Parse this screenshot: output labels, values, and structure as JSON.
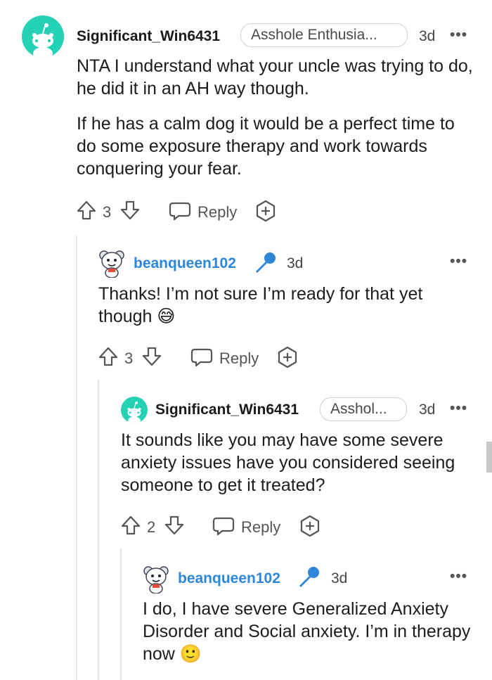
{
  "comments": [
    {
      "username": "Significant_Win6431",
      "flair": "Asshole Enthusia...",
      "age": "3d",
      "more": "•••",
      "paragraphs": [
        "NTA I understand what your uncle was trying to do, he did it in an AH way though.",
        "If he has a calm dog it would be a perfect time to do some exposure therapy and work towards conquering your fear."
      ],
      "votes": "3",
      "reply_label": "Reply"
    },
    {
      "username": "beanqueen102",
      "age": "3d",
      "more": "•••",
      "paragraphs": [
        "Thanks! I’m not sure I’m ready for that yet though 😅"
      ],
      "votes": "3",
      "reply_label": "Reply"
    },
    {
      "username": "Significant_Win6431",
      "flair": "Asshol...",
      "age": "3d",
      "more": "•••",
      "paragraphs": [
        "It sounds like you may have some severe anxiety issues have you considered seeing someone to get it treated?"
      ],
      "votes": "2",
      "reply_label": "Reply"
    },
    {
      "username": "beanqueen102",
      "age": "3d",
      "more": "•••",
      "paragraphs": [
        "I do, I have severe Generalized Anxiety Disorder and Social anxiety. I’m in therapy now 🙂"
      ]
    }
  ],
  "colors": {
    "avatar_bg": "#24d1b5",
    "op_username": "#2e86d8",
    "mic_icon": "#2e86d8"
  }
}
